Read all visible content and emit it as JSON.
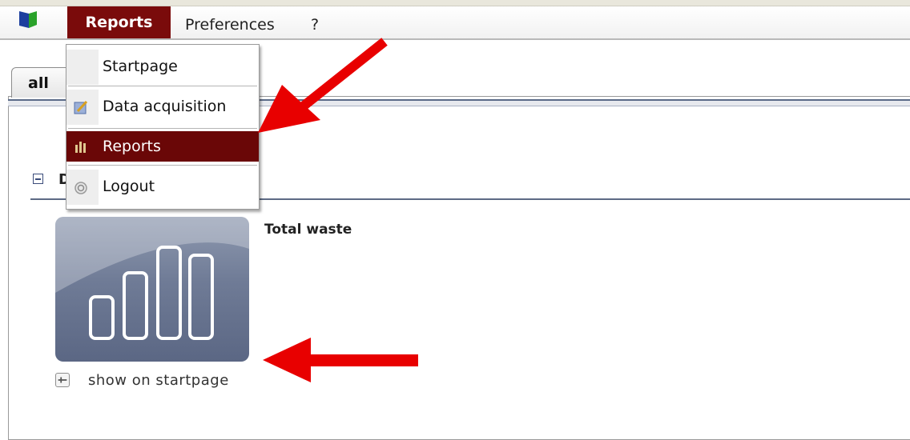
{
  "menubar": {
    "logo_icon": "app-logo-icon",
    "items": [
      {
        "label": "Reports",
        "active": true
      },
      {
        "label": "Preferences"
      },
      {
        "label": "?"
      }
    ]
  },
  "tabs": [
    {
      "label": "all"
    }
  ],
  "dropdown": {
    "items": [
      {
        "label": "Startpage",
        "icon": ""
      },
      {
        "label": "Data acquisition",
        "icon": "edit-note-icon"
      },
      {
        "label": "Reports",
        "icon": "bar-chart-icon",
        "highlighted": true
      },
      {
        "label": "Logout",
        "icon": "power-icon"
      }
    ]
  },
  "section": {
    "title": "D"
  },
  "report": {
    "title": "Total waste",
    "pin_label": "show on startpage"
  },
  "colors": {
    "accent": "#7a0b0b",
    "arrow": "#e80000",
    "tile": "#6f7b96"
  }
}
